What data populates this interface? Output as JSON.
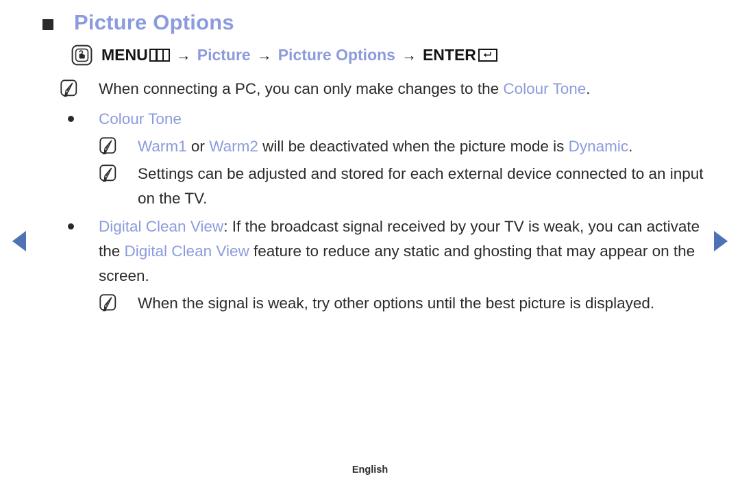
{
  "colors": {
    "accent": "#8b9bdd",
    "text": "#2b2b2b",
    "marker": "#2c2a29",
    "nav_arrow": "#4f72b7"
  },
  "header": {
    "marker_icon": "square-marker-icon",
    "title": "Picture Options"
  },
  "navigation_path": {
    "key_icon": "menu-key-icon",
    "menu_label": "MENU",
    "menu_glyph_icon": "menu-box-icon",
    "arrow1": "→",
    "item1": "Picture",
    "arrow2": "→",
    "item2": "Picture Options",
    "arrow3": "→",
    "enter_label": "ENTER",
    "enter_glyph_icon": "enter-return-icon"
  },
  "content": {
    "note_pc": {
      "icon": "note-pencil-icon",
      "text_before": "When connecting a PC, you can only make changes to the ",
      "accent": "Colour Tone",
      "text_after": "."
    },
    "bullet_colour_tone": {
      "icon": "bullet-dot-icon",
      "label": "Colour Tone"
    },
    "note_warm": {
      "icon": "note-pencil-icon",
      "accent1": "Warm1",
      "mid1": " or ",
      "accent2": "Warm2",
      "mid2": " will be deactivated when the picture mode is ",
      "accent3": "Dynamic",
      "tail": "."
    },
    "note_settings": {
      "icon": "note-pencil-icon",
      "text": "Settings can be adjusted and stored for each external device connected to an input on the TV."
    },
    "bullet_digital_clean_view": {
      "icon": "bullet-dot-icon",
      "accent1": "Digital Clean View",
      "mid1": ": If the broadcast signal received by your TV is weak, you can activate the ",
      "accent2": "Digital Clean View",
      "mid2": " feature to reduce any static and ghosting that may appear on the screen."
    },
    "note_signal": {
      "icon": "note-pencil-icon",
      "text": "When the signal is weak, try other options until the best picture is displayed."
    }
  },
  "page_nav": {
    "prev_icon": "triangle-left-icon",
    "next_icon": "triangle-right-icon"
  },
  "footer": {
    "language": "English"
  }
}
